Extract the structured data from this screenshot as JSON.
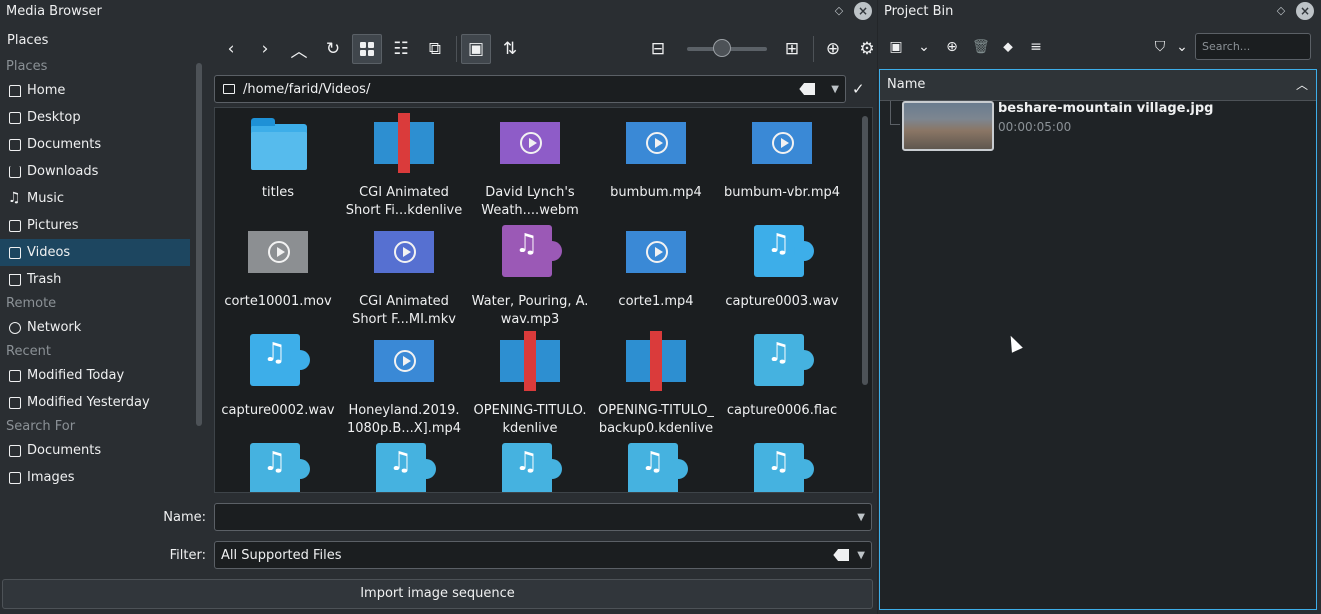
{
  "media_browser": {
    "title": "Media Browser",
    "places_header": "Places",
    "sections": [
      {
        "label": "Places",
        "items": [
          {
            "label": "Home",
            "icon": "home-icon"
          },
          {
            "label": "Desktop",
            "icon": "desktop-icon"
          },
          {
            "label": "Documents",
            "icon": "documents-icon"
          },
          {
            "label": "Downloads",
            "icon": "downloads-icon"
          },
          {
            "label": "Music",
            "icon": "music-icon"
          },
          {
            "label": "Pictures",
            "icon": "pictures-icon"
          },
          {
            "label": "Videos",
            "icon": "videos-icon",
            "selected": true
          },
          {
            "label": "Trash",
            "icon": "trash-icon"
          }
        ]
      },
      {
        "label": "Remote",
        "items": [
          {
            "label": "Network",
            "icon": "network-icon"
          }
        ]
      },
      {
        "label": "Recent",
        "items": [
          {
            "label": "Modified Today",
            "icon": "calendar-icon"
          },
          {
            "label": "Modified Yesterday",
            "icon": "calendar-icon"
          }
        ]
      },
      {
        "label": "Search For",
        "items": [
          {
            "label": "Documents",
            "icon": "search-documents-icon"
          },
          {
            "label": "Images",
            "icon": "search-images-icon"
          }
        ]
      }
    ],
    "path": "/home/farid/Videos/",
    "files": [
      {
        "line1": "titles",
        "line2": "",
        "kind": "folder"
      },
      {
        "line1": "CGI Animated",
        "line2": "Short Fi...kdenlive",
        "kind": "kden"
      },
      {
        "line1": "David Lynch's",
        "line2": "Weath....webm",
        "kind": "video-purple"
      },
      {
        "line1": "bumbum.mp4",
        "line2": "",
        "kind": "video-blue"
      },
      {
        "line1": "bumbum-vbr.mp4",
        "line2": "",
        "kind": "video-blue"
      },
      {
        "line1": "corte10001.mov",
        "line2": "",
        "kind": "video-gray"
      },
      {
        "line1": "CGI Animated",
        "line2": "Short F...MI.mkv",
        "kind": "video-indigo"
      },
      {
        "line1": "Water, Pouring, A.",
        "line2": "wav.mp3",
        "kind": "audio-purple"
      },
      {
        "line1": "corte1.mp4",
        "line2": "",
        "kind": "video-blue"
      },
      {
        "line1": "capture0003.wav",
        "line2": "",
        "kind": "audio"
      },
      {
        "line1": "capture0002.wav",
        "line2": "",
        "kind": "audio"
      },
      {
        "line1": "Honeyland.2019.",
        "line2": "1080p.B...X].mp4",
        "kind": "video-blue"
      },
      {
        "line1": "OPENING-TITULO.",
        "line2": "kdenlive",
        "kind": "kden"
      },
      {
        "line1": "OPENING-TITULO_",
        "line2": "backup0.kdenlive",
        "kind": "kden"
      },
      {
        "line1": "capture0006.flac",
        "line2": "",
        "kind": "audio-teal"
      },
      {
        "line1": "",
        "line2": "",
        "kind": "audio-teal"
      },
      {
        "line1": "",
        "line2": "",
        "kind": "audio-teal"
      },
      {
        "line1": "",
        "line2": "",
        "kind": "audio-teal"
      },
      {
        "line1": "",
        "line2": "",
        "kind": "audio-teal"
      },
      {
        "line1": "",
        "line2": "",
        "kind": "audio-teal"
      }
    ],
    "name_label": "Name:",
    "name_value": "",
    "filter_label": "Filter:",
    "filter_value": "All Supported Files",
    "import_button": "Import image sequence"
  },
  "project_bin": {
    "title": "Project Bin",
    "search_placeholder": "Search...",
    "column_name": "Name",
    "clip": {
      "name": "beshare-mountain village.jpg",
      "duration": "00:00:05:00"
    }
  }
}
